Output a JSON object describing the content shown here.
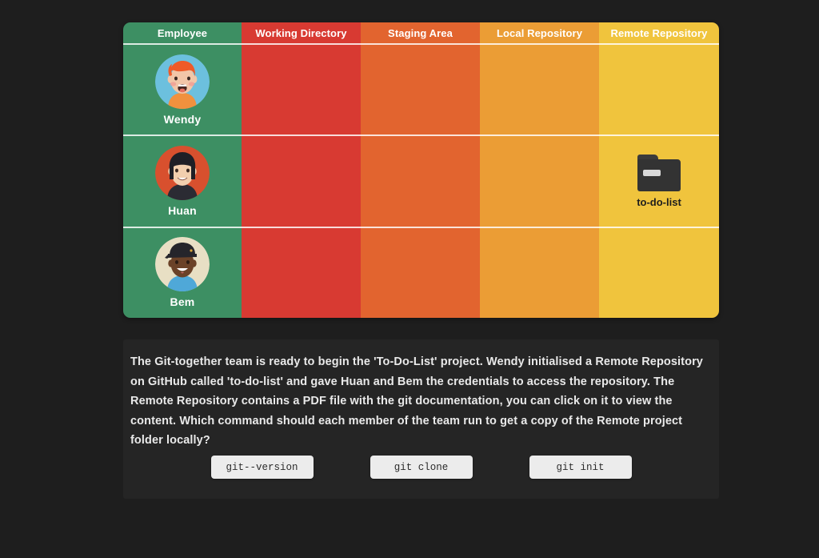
{
  "table": {
    "columns": [
      {
        "label": "Employee",
        "color": "#3d8f63"
      },
      {
        "label": "Working Directory",
        "color": "#d83a32"
      },
      {
        "label": "Staging Area",
        "color": "#e2642f"
      },
      {
        "label": "Local Repository",
        "color": "#eb9d35"
      },
      {
        "label": "Remote Repository",
        "color": "#f0c43d"
      }
    ],
    "rows": [
      {
        "employee": "Wendy",
        "avatar": "avatar-wendy-icon",
        "working_directory": "",
        "staging_area": "",
        "local_repository": "",
        "remote_repository": ""
      },
      {
        "employee": "Huan",
        "avatar": "avatar-huan-icon",
        "working_directory": "",
        "staging_area": "",
        "local_repository": "",
        "remote_repository": "to-do-list"
      },
      {
        "employee": "Bem",
        "avatar": "avatar-bem-icon",
        "working_directory": "",
        "staging_area": "",
        "local_repository": "",
        "remote_repository": ""
      }
    ],
    "remote_folder": {
      "icon": "folder-icon",
      "name": "to-do-list"
    }
  },
  "panel": {
    "question": "The Git-together team is ready to begin the 'To-Do-List' project. Wendy initialised a Remote Repository on GitHub called 'to-do-list' and gave Huan and Bem the credentials to access the repository. The Remote Repository contains a PDF file with the git documentation, you can click on it to view the content. Which command should each member of the team run to get a copy of the Remote project folder locally?",
    "answers": [
      {
        "label": "git--version"
      },
      {
        "label": "git clone"
      },
      {
        "label": "git init"
      }
    ]
  },
  "theme": {
    "page_background": "#1e1e1e",
    "panel_background": "#252525",
    "text_light": "#e9e9e9",
    "button_background": "#ececec",
    "button_text": "#2b2b2b",
    "separator": "#ffffff"
  }
}
